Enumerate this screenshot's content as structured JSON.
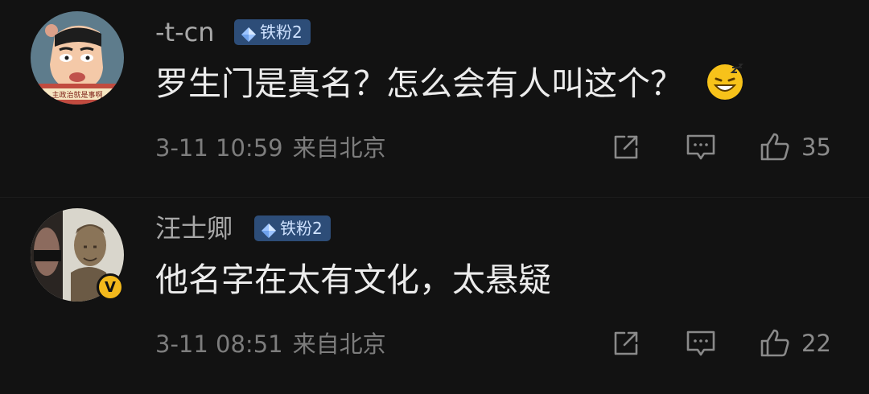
{
  "comments": [
    {
      "username": "-t-cn",
      "badge": "铁粉2",
      "content": "罗生门是真名？怎么会有人叫这个？",
      "emoji_icon": "sweat-grin-emoji",
      "time": "3-11 10:59",
      "location": "来自北京",
      "avatar_caption": "主政治就是事啊",
      "likes": "35"
    },
    {
      "username": "汪士卿",
      "badge": "铁粉2",
      "content": "他名字在太有文化，太悬疑",
      "time": "3-11 08:51",
      "location": "来自北京",
      "verified_mark": "V",
      "likes": "22"
    }
  ],
  "icons": {
    "share": "share-icon",
    "comment": "comment-icon",
    "like": "thumbs-up-icon",
    "badge_gem": "diamond-icon"
  },
  "colors": {
    "background": "#121212",
    "badge_bg": "#2d4d78",
    "verified": "#f3b91c"
  }
}
